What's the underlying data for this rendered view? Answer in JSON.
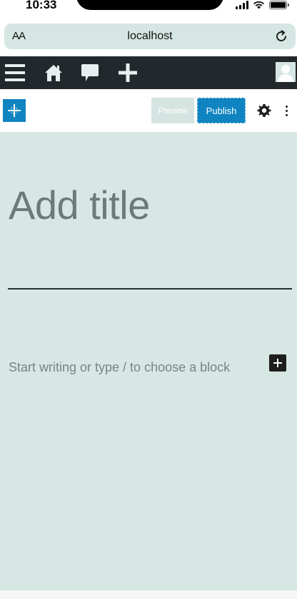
{
  "status_bar": {
    "time": "10:33"
  },
  "browser": {
    "text_size_label": "AA",
    "url": "localhost"
  },
  "admin_bar": {
    "items": [
      "menu-icon",
      "home-icon",
      "comments-icon",
      "new-content-icon",
      "avatar"
    ]
  },
  "editor_header": {
    "preview_label": "Preview",
    "publish_label": "Publish"
  },
  "editor": {
    "title_placeholder": "Add title",
    "block_placeholder": "Start writing or type / to choose a block"
  },
  "colors": {
    "admin_bar": "#23282d",
    "accent": "#0f84c1",
    "canvas": "#d7e7e3",
    "address_bar": "#d6e6e2"
  }
}
